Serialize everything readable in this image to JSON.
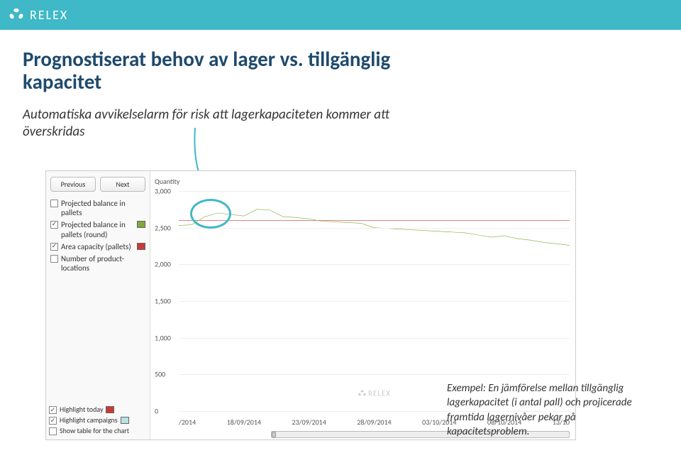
{
  "brand": "RELEX",
  "title": "Prognostiserat behov av lager vs. tillgänglig kapacitet",
  "subtitle": "Automatiska avvikelselarm för risk att lagerkapaciteten kommer att överskridas",
  "example_caption": "Exempel: En jämförelse mellan tillgänglig lagerkapacitet (i antal pall) och projicerade framtida lagernivåer pekar på kapacitetsproblem.",
  "nav": {
    "prev": "Previous",
    "next": "Next"
  },
  "legend": [
    {
      "label": "Projected balance in pallets",
      "checked": false,
      "color": ""
    },
    {
      "label": "Projected balance in pallets (round)",
      "checked": true,
      "color": "#7fa93a"
    },
    {
      "label": "Area capacity (pallets)",
      "checked": true,
      "color": "#c93a36"
    },
    {
      "label": "Number of product-locations",
      "checked": false,
      "color": ""
    }
  ],
  "controls": [
    {
      "label": "Highlight today",
      "checked": true,
      "color": "#c93a36"
    },
    {
      "label": "Highlight campaigns",
      "checked": true,
      "color": "#b7e2e6"
    },
    {
      "label": "Show table for the chart",
      "checked": false,
      "color": ""
    }
  ],
  "chart_data": {
    "type": "line",
    "title": "",
    "xlabel": "",
    "ylabel": "Quantity",
    "ylim": [
      0,
      3000
    ],
    "yticks": [
      0,
      500,
      1000,
      1500,
      2000,
      2500,
      3000
    ],
    "x": [
      "/2014",
      "18/09/2014",
      "23/09/2014",
      "28/09/2014",
      "03/10/2014",
      "08/10/2014",
      "13/10"
    ],
    "series": [
      {
        "name": "Area capacity (pallets)",
        "color": "#c93a36",
        "values": [
          2600,
          2600,
          2600,
          2600,
          2600,
          2600,
          2600,
          2600,
          2600,
          2600,
          2600,
          2600,
          2600,
          2600,
          2600,
          2600,
          2600,
          2600,
          2600,
          2600,
          2600,
          2600,
          2600,
          2600,
          2600,
          2600,
          2600,
          2600,
          2600,
          2600,
          2600
        ]
      },
      {
        "name": "Projected balance in pallets (round)",
        "color": "#7fa93a",
        "values": [
          2530,
          2540,
          2650,
          2700,
          2680,
          2660,
          2750,
          2740,
          2650,
          2640,
          2620,
          2590,
          2580,
          2570,
          2560,
          2500,
          2490,
          2480,
          2470,
          2460,
          2450,
          2440,
          2430,
          2400,
          2370,
          2390,
          2350,
          2330,
          2300,
          2280,
          2260
        ]
      }
    ]
  }
}
